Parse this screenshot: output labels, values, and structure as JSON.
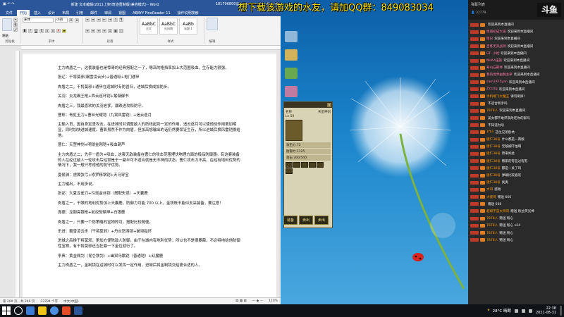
{
  "word": {
    "title": "新建 文本编辑(2011上架)奇迹重制版(兼容模式) - Word",
    "account": "181796800@qq.com",
    "tabs": [
      "文件",
      "开始",
      "插入",
      "设计",
      "布局",
      "引用",
      "邮件",
      "审阅",
      "视图",
      "ABBYY FineReader 11",
      "操作说明搜索"
    ],
    "active_tab": "开始",
    "ribbon": {
      "paste_label": "粘贴",
      "clipboard_label": "剪贴板",
      "font_label": "字体",
      "paragraph_label": "段落",
      "styles_label": "样式",
      "editing_label": "编辑",
      "font_name": "宋体",
      "font_size": "小四",
      "styles": [
        {
          "sample": "AaBbC",
          "name": "正文"
        },
        {
          "sample": "AaBbC",
          "name": "无间隔"
        },
        {
          "sample": "AaBb",
          "name": "标题 1"
        }
      ]
    },
    "paragraphs": [
      "主力肉盾之一，这套装备也是悻哥的经典搭配之一了，嗯高的格挡率加上大范围吸血，生存能力很强。",
      "张辽：干将莫邪(霸雪凌云步)+普通吸+电门通甲",
      "肉盾之二，干将莫邪+通甲在适城时专防冒归，进城后换成加防步。",
      "关羽：炎龙霸王枪+西云连环铠+紫薇御书",
      "肉盾之三，我最喜欢的关羽老爹，暴跌进攻和防守。",
      "曹彰：青釭玉刀+曹丝光耀铠（九霄风雷铠）+追云逐月",
      "主输入员，因自身定坚攻击，在进城时对调整敌人的防线起到一定的作用，追云逐月可以使他动作用更加明显，同时加快进城速度。曹彰虽然不作为肉盾，但加高想输出的话仍然要保证生存，所以进城后换风雷铠换给他。",
      "曹仁：天罡神剑+明锁金刚铠+吸血葫芦",
      "主力肉盾之二，先手一盾为+吸血，这套无敌装备在曹仁的攻击范围埋伏物理方面的极品防御器。有这套装备的人在经过敌人一轮攻击后经常是于一副半可不适合就是无不神的状态。曹仁攻击力不高，在经有地利优势的情况下，我一般只考虑他的防守优势。",
      "夏侯渊：虎翼弦弓+修罗精钢铠+天马穿宝",
      "主力输出，不用多说。",
      "张郃：大夏龙雀刀+玲珑金丝铠（搭配失误）+天囊鹿",
      "肉盾之一，干眼的地利优势加上天囊鹿，防御力可能 700 以上，金铁既不能似支采装备，要注意！",
      "庞德：龙胆亮银枪+蛇纹软鳞甲+白银鹿",
      "肉盾之一，只要一个防策略的宝物即可，搭配比较随便。",
      "乐进：霸雪凌云步（干将莫邪）+丹炎怒涛铠+破坦指环",
      "进城之后换干将莫邪，更加方便陈敌人防御，由于在城内有地利优势，所以也不是很要薛，不必特地给他防御性宝物，有干将莫邪还当狂暴一下金位就行了。",
      "李典：黄金佩剑（昆仑铁剑）+幽冥乌鹏铠（普通铠）+幻魔鹿",
      "主力肉盾之一，金制锁在运城时可以发挥一定作用，进城后将金制锁交给更合适的人。"
    ],
    "status": {
      "page": "第 200 页，共 249 页",
      "words": "33784 个字",
      "lang": "中文(中国)",
      "zoom": "110%"
    }
  },
  "overlay_text": "想下载该游戏的水友，请加QQ群：849083034",
  "game": {
    "name_label": "名称",
    "name": "天罡神剑",
    "lv": "Lv 50",
    "stats": [
      "攻击力 72",
      "防御力 1125",
      "攻击 300/500"
    ],
    "buttons": [
      "装备",
      "卖出",
      "卖出"
    ]
  },
  "chat": {
    "room_title": "弹幕列表",
    "viewers": "32779",
    "logo": "斗鱼",
    "messages": [
      {
        "user": "",
        "text": "欢迎来到本直播间",
        "welcome": true
      },
      {
        "user": "悟道初成大道",
        "text": "欢迎来到本直播间",
        "welcome": true
      },
      {
        "user": "悟日",
        "text": "欢迎来到本直播间",
        "welcome": true
      },
      {
        "user": "百炼无双战神",
        "text": "欢迎来到本直播间",
        "welcome": true
      },
      {
        "user": "GT- 小蛙",
        "text": "欢迎来到本直播间",
        "welcome": true
      },
      {
        "user": "NUAA虫族",
        "text": "欢迎来到本直播间",
        "welcome": true
      },
      {
        "user": "寿山石羁绊",
        "text": "欢迎来到本直播间",
        "welcome": true
      },
      {
        "user": "我的世界由我主宰",
        "text": "欢迎来到本直播间",
        "welcome": true
      },
      {
        "user": "sam1975yan",
        "text": "欢迎来到本直播间",
        "welcome": true
      },
      {
        "user": "Zzzzzg",
        "text": "欢迎来到本直播间",
        "welcome": true
      },
      {
        "user": "手机端飞大魔王",
        "text": "请勿刷屏!",
        "welcome": false
      },
      {
        "user": "",
        "text": "不适合新手吗",
        "welcome": false
      },
      {
        "user": "7878人",
        "text": "欢迎来到本直播间",
        "welcome": false
      },
      {
        "user": "",
        "text": "美女都不敢评就改吃你的家吗",
        "welcome": false
      },
      {
        "user": "",
        "text": "不知道为啥",
        "welcome": false
      },
      {
        "user": "1fb1",
        "text": "这位兄弟别坑",
        "welcome": false
      },
      {
        "user": "傲仁38号",
        "text": "什么都是一两版",
        "welcome": false
      },
      {
        "user": "傲仁38号",
        "text": "无敌被吓怕啊",
        "welcome": false
      },
      {
        "user": "傲仁38号",
        "text": "原来如此",
        "welcome": false
      },
      {
        "user": "傲仁38号",
        "text": "畅家的有些过程有",
        "welcome": false
      },
      {
        "user": "傲仁38号",
        "text": "都是一关了吗",
        "welcome": false
      },
      {
        "user": "傲仁38号",
        "text": "弹幕比较喜欢",
        "welcome": false
      },
      {
        "user": "傲仁38号",
        "text": "奥奥",
        "welcome": false
      },
      {
        "user": "大哥",
        "text": "感谢",
        "welcome": false
      },
      {
        "user": "大佬哥",
        "text": "赠送 666",
        "welcome": false
      },
      {
        "user": "",
        "text": "赠送 666",
        "welcome": false
      },
      {
        "user": "超级宇宙大师哥",
        "text": "赠送 粉丝荧光棒",
        "welcome": false
      },
      {
        "user": "7878人",
        "text": "赠送 粉心",
        "welcome": false
      },
      {
        "user": "7878人",
        "text": "赠送 粉心 x24",
        "welcome": false
      },
      {
        "user": "7878人",
        "text": "赠送 粉心",
        "welcome": false
      },
      {
        "user": "7878人",
        "text": "赠送 粉心",
        "welcome": false
      }
    ]
  },
  "taskbar": {
    "weather": "28°C 晴朗",
    "time": "22:38",
    "date": "2021-08-31"
  }
}
